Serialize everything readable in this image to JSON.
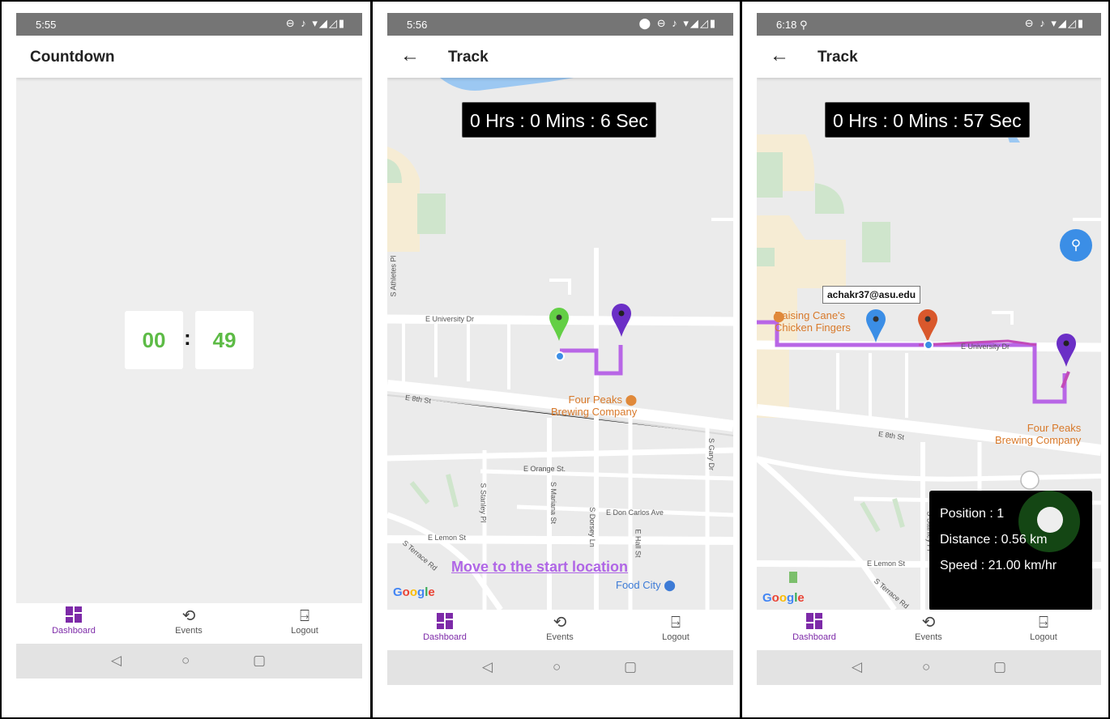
{
  "screen1": {
    "status_time": "5:55",
    "status_icons": "⊖ ♪ ▾◢◿▮",
    "title": "Countdown",
    "minutes": "00",
    "colon": ":",
    "seconds": "49"
  },
  "screen2": {
    "status_time": "5:56",
    "status_icons": "⬤ ⊖ ♪ ▾◢◿▮",
    "back_icon": "←",
    "title": "Track",
    "timer": "0 Hrs : 0 Mins : 6 Sec",
    "map_labels": {
      "univ": "E University Dr",
      "eighth": "E 8th St",
      "orange": "E Orange St.",
      "doncarlos": "E Don Carlos Ave",
      "lemon": "E Lemon St",
      "terrace": "S Terrace Rd",
      "stanley": "S Stanley Pl",
      "mariana": "S Mariana St",
      "dorsey": "S Dorsey Ln",
      "hall": "E Hall St",
      "gary": "S Gary Dr",
      "athletes": "S Athletes Pl"
    },
    "poi_fourpeaks": [
      "Four Peaks",
      "Brewing Company"
    ],
    "poi_foodcity": "Food City",
    "move_label": "Move to the start location"
  },
  "screen3": {
    "status_time": "6:18",
    "status_icons": "⊖ ♪ ▾◢◿▮",
    "back_icon": "←",
    "title": "Track",
    "timer": "0 Hrs : 0 Mins : 57 Sec",
    "callout": "achakr37@asu.edu",
    "map_labels": {
      "univ": "E University Dr",
      "eighth": "E 8th St",
      "lemon": "E Lemon St",
      "terrace": "S Terrace Rd",
      "stanley": "S Stanley Pl"
    },
    "poi_canes": [
      "Raising Cane's",
      "Chicken Fingers"
    ],
    "poi_fourpeaks": [
      "Four Peaks",
      "Brewing Company"
    ],
    "info": {
      "position": "Position : 1",
      "distance": "Distance : 0.56 km",
      "speed": "Speed : 21.00 km/hr"
    }
  },
  "google": {
    "g": "G",
    "o1": "o",
    "o2": "o",
    "g2": "g",
    "l": "l",
    "e": "e"
  },
  "nav": {
    "dashboard": "Dashboard",
    "events": "Events",
    "logout": "Logout"
  },
  "sysnav": {
    "back": "◁",
    "home": "○",
    "recents": "▢"
  },
  "colors": {
    "accent": "#7d2aa8",
    "countdown": "#5dbb46",
    "route": "#b866e6"
  }
}
